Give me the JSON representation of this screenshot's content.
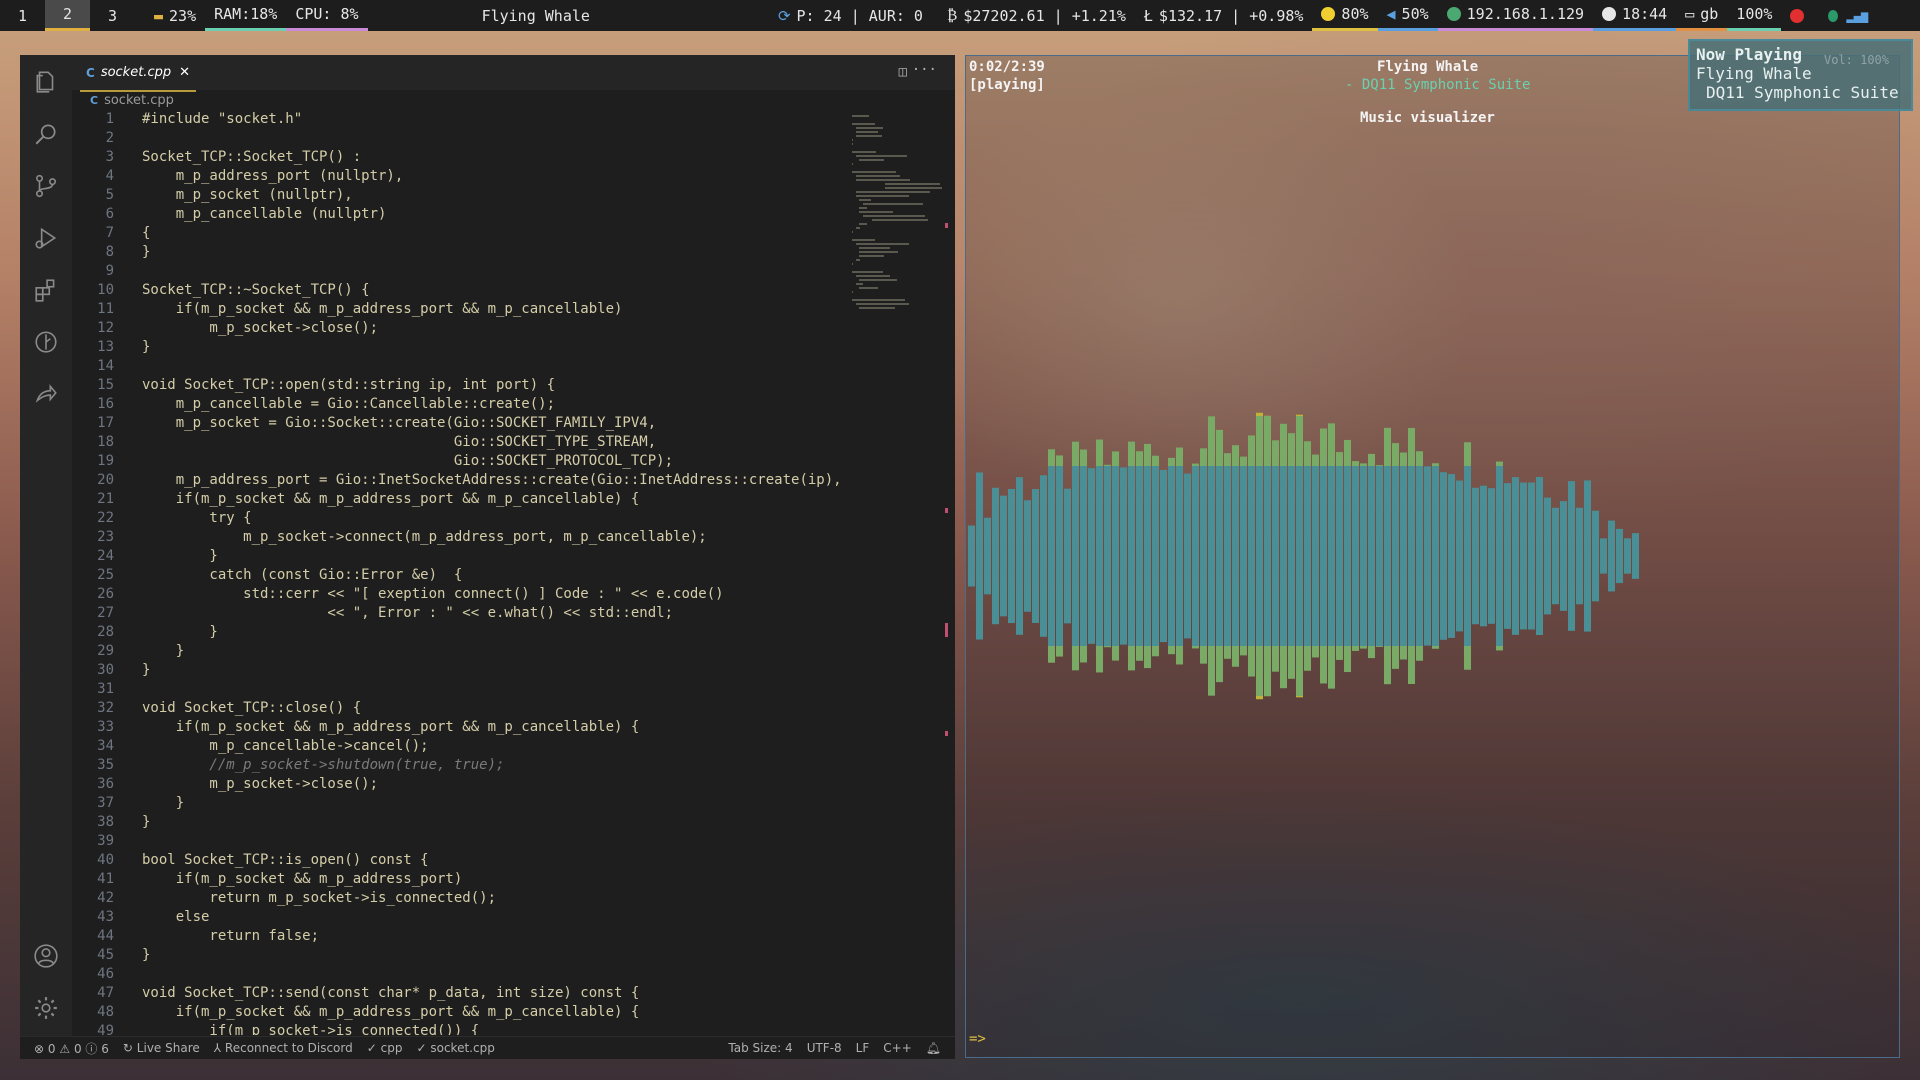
{
  "topbar": {
    "workspaces": [
      "1",
      "2",
      "3"
    ],
    "active_workspace": "2",
    "disk": "23%",
    "ram": "RAM:18%",
    "cpu": "CPU: 8%",
    "title": "Flying Whale",
    "updates": "P: 24 | AUR: 0",
    "btc": "$27202.61 | +1.21%",
    "ltc": "$132.17 | +0.98%",
    "brightness": "80%",
    "volume": "50%",
    "ip": "192.168.1.129",
    "time": "18:44",
    "keyboard": "gb",
    "battery": "100%"
  },
  "editor": {
    "tab_label": "socket.cpp",
    "breadcrumb": "socket.cpp",
    "lines": [
      "#include \"socket.h\"",
      "",
      "Socket_TCP::Socket_TCP() :",
      "    m_p_address_port (nullptr),",
      "    m_p_socket (nullptr),",
      "    m_p_cancellable (nullptr)",
      "{",
      "}",
      "",
      "Socket_TCP::~Socket_TCP() {",
      "    if(m_p_socket && m_p_address_port && m_p_cancellable)",
      "        m_p_socket->close();",
      "}",
      "",
      "void Socket_TCP::open(std::string ip, int port) {",
      "    m_p_cancellable = Gio::Cancellable::create();",
      "    m_p_socket = Gio::Socket::create(Gio::SOCKET_FAMILY_IPV4,",
      "                                     Gio::SOCKET_TYPE_STREAM,",
      "                                     Gio::SOCKET_PROTOCOL_TCP);",
      "    m_p_address_port = Gio::InetSocketAddress::create(Gio::InetAddress::create(ip),",
      "    if(m_p_socket && m_p_address_port && m_p_cancellable) {",
      "        try {",
      "            m_p_socket->connect(m_p_address_port, m_p_cancellable);",
      "        }",
      "        catch (const Gio::Error &e)  {",
      "            std::cerr << \"[ exeption connect() ] Code : \" << e.code()",
      "                      << \", Error : \" << e.what() << std::endl;",
      "        }",
      "    }",
      "}",
      "",
      "void Socket_TCP::close() {",
      "    if(m_p_socket && m_p_address_port && m_p_cancellable) {",
      "        m_p_cancellable->cancel();",
      "        //m_p_socket->shutdown(true, true);",
      "        m_p_socket->close();",
      "    }",
      "}",
      "",
      "bool Socket_TCP::is_open() const {",
      "    if(m_p_socket && m_p_address_port)",
      "        return m_p_socket->is_connected();",
      "    else",
      "        return false;",
      "}",
      "",
      "void Socket_TCP::send(const char* p_data, int size) const {",
      "    if(m_p_socket && m_p_address_port && m_p_cancellable) {",
      "        if(m_p_socket->is_connected()) {"
    ],
    "status": {
      "errors": "0",
      "warnings": "0",
      "info": "6",
      "live_share": "Live Share",
      "discord": "Reconnect to Discord",
      "lang_check": "cpp",
      "file_check": "socket.cpp",
      "tab_size": "Tab Size: 4",
      "encoding": "UTF-8",
      "eol": "LF",
      "language": "C++"
    }
  },
  "visualizer": {
    "time": "0:02/2:39",
    "state": "[playing]",
    "track_title": "Flying Whale",
    "track_album": "- DQ11 Symphonic Suite",
    "window_title": "Music visualizer",
    "prompt": "=>"
  },
  "notification": {
    "heading": "Now Playing",
    "title": "Flying Whale",
    "album": "DQ11 Symphonic Suite",
    "volume": "Vol: 100%"
  },
  "colors": {
    "accent": "#e0b040",
    "viz_teal": "#4a8e96",
    "viz_green": "#7aab66",
    "viz_yellow": "#bfb23a"
  }
}
